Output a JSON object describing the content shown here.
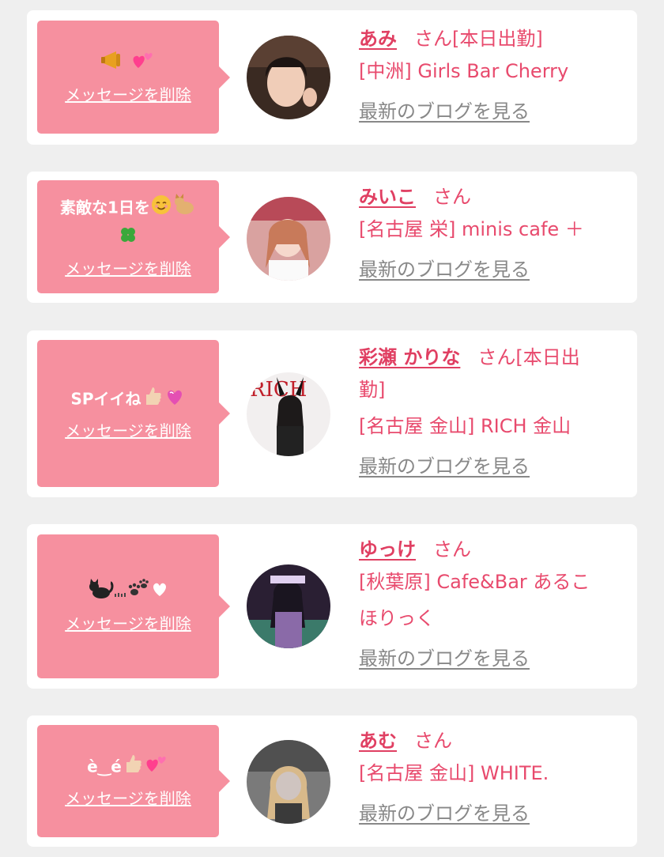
{
  "theme": {
    "accent": "#e03f62",
    "bubble": "#f6909f",
    "link_gray": "#888888",
    "background": "#efefef"
  },
  "common": {
    "delete_label": "メッセージを削除",
    "blog_label": "最新のブログを見る",
    "san": "さん"
  },
  "cards": [
    {
      "message": "",
      "message_icons": [
        "megaphone-icon",
        "two-hearts-icon"
      ],
      "name": "あみ",
      "suffix": "さん[本日出勤]",
      "shop": "[中洲] Girls Bar Cherry",
      "avatar": "woman-dark-hair-avatar"
    },
    {
      "message": "素敵な1日を",
      "message_icons": [
        "smiling-face-icon",
        "cat-icon",
        "four-leaf-clover-icon"
      ],
      "name": "みいこ",
      "suffix": "さん",
      "shop": "[名古屋 栄] minis cafe ＋",
      "avatar": "woman-red-backdrop-avatar"
    },
    {
      "message": "SPイイね",
      "message_icons": [
        "thumbs-up-icon",
        "sparkling-heart-icon"
      ],
      "name": "彩瀬 かりな",
      "suffix": "さん[本日出",
      "suffix2": "勤]",
      "shop": "[名古屋 金山] RICH 金山",
      "avatar": "magazine-cover-avatar"
    },
    {
      "message": "",
      "message_icons": [
        "black-cat-icon",
        "paw-prints-icon",
        "heart-icon"
      ],
      "name": "ゆっけ",
      "suffix": "さん",
      "shop": "[秋葉原] Cafe&Bar あるこ",
      "shop2": "ほりっく",
      "avatar": "gothic-costume-avatar"
    },
    {
      "message": "è‿é",
      "message_icons": [
        "thumbs-up-icon",
        "two-hearts-icon"
      ],
      "name": "あむ",
      "suffix": "さん",
      "shop": "[名古屋 金山] WHITE.",
      "avatar": "blonde-woman-avatar"
    }
  ]
}
